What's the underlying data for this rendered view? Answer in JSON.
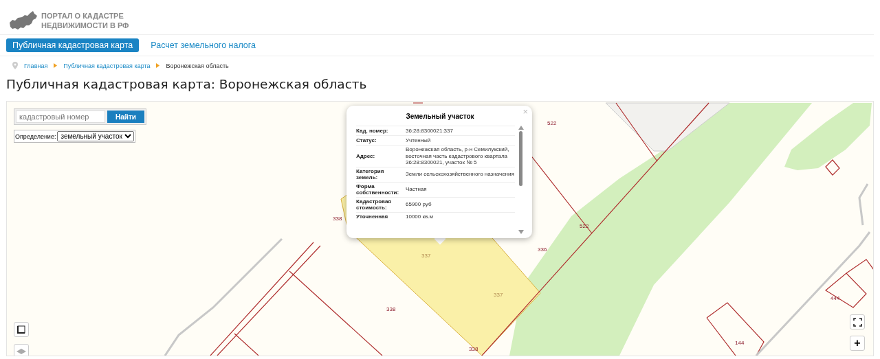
{
  "header": {
    "logo_lines": [
      "ПОРТАЛ О КАДАСТРЕ",
      "НЕДВИЖИМОСТИ В РФ"
    ]
  },
  "nav": [
    {
      "label": "Публичная кадастровая карта",
      "selected": true
    },
    {
      "label": "Расчет земельного налога",
      "selected": false
    }
  ],
  "breadcrumbs": [
    {
      "label": "Главная",
      "link": true
    },
    {
      "label": "Публичная кадастровая карта",
      "link": true
    },
    {
      "label": "Воронежская область",
      "link": false
    }
  ],
  "page_title": "Публичная кадастровая карта: Воронежская область",
  "map": {
    "search": {
      "placeholder": "кадастровый номер",
      "button": "Найти"
    },
    "definition": {
      "label": "Определение:",
      "value": "земельный участок"
    },
    "popup": {
      "title": "Земельный участок",
      "close": "×",
      "rows": [
        {
          "label": "Кад. номер:",
          "value": "36:28:8300021:337"
        },
        {
          "label": "Статус:",
          "value": "Учтенный"
        },
        {
          "label": "Адрес:",
          "value": "Воронежская область, р-н Семилукский, восточная часть кадастрового квартала 36:28:8300021, участок № 5"
        },
        {
          "label": "Категория земель:",
          "value": "Земли сельскохозяйственного назначения"
        },
        {
          "label": "Форма собственности:",
          "value": "Частная"
        },
        {
          "label": "Кадастровая стоимость:",
          "value": "65900 руб"
        },
        {
          "label": "Уточненная",
          "value": "10000 кв.м"
        }
      ]
    },
    "parcel_labels": [
      {
        "text": "522",
        "selected": false
      },
      {
        "text": "522",
        "selected": false
      },
      {
        "text": "338",
        "selected": false
      },
      {
        "text": "337",
        "selected": true
      },
      {
        "text": "336",
        "selected": false
      },
      {
        "text": "337",
        "selected": true
      },
      {
        "text": "338",
        "selected": false
      },
      {
        "text": "338",
        "selected": false
      },
      {
        "text": "444",
        "selected": false
      },
      {
        "text": "144",
        "selected": false
      }
    ],
    "zoom_in": "+"
  }
}
